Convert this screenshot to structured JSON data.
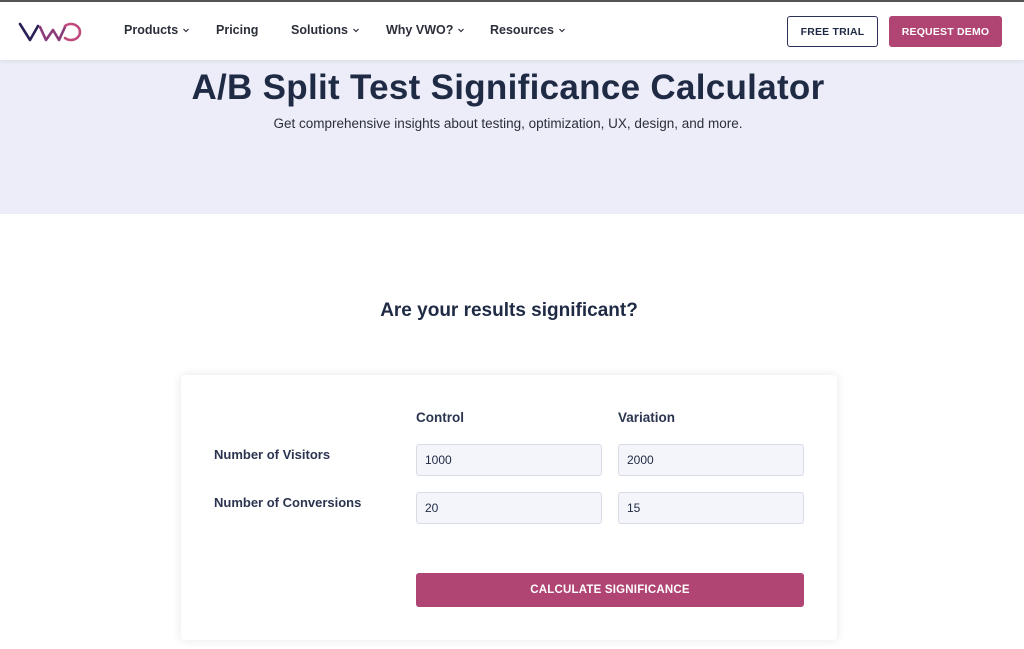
{
  "brand": {
    "logo_text": "VWO",
    "primary_color": "#b04472",
    "navy_color": "#1f2a44",
    "hero_bg": "#ecedf8"
  },
  "nav": {
    "items": [
      {
        "label": "Products",
        "has_dropdown": true
      },
      {
        "label": "Pricing",
        "has_dropdown": false
      },
      {
        "label": "Solutions",
        "has_dropdown": true
      },
      {
        "label": "Why VWO?",
        "has_dropdown": true
      },
      {
        "label": "Resources",
        "has_dropdown": true
      }
    ],
    "free_trial_label": "FREE TRIAL",
    "request_demo_label": "REQUEST DEMO"
  },
  "hero": {
    "title": "A/B Split Test Significance Calculator",
    "subtitle": "Get comprehensive insights about testing, optimization, UX, design, and more."
  },
  "calculator": {
    "section_title": "Are your results significant?",
    "columns": [
      "Control",
      "Variation"
    ],
    "rows": [
      {
        "label": "Number of Visitors",
        "control": "1000",
        "variation": "2000"
      },
      {
        "label": "Number of Conversions",
        "control": "20",
        "variation": "15"
      }
    ],
    "submit_label": "CALCULATE SIGNIFICANCE"
  }
}
